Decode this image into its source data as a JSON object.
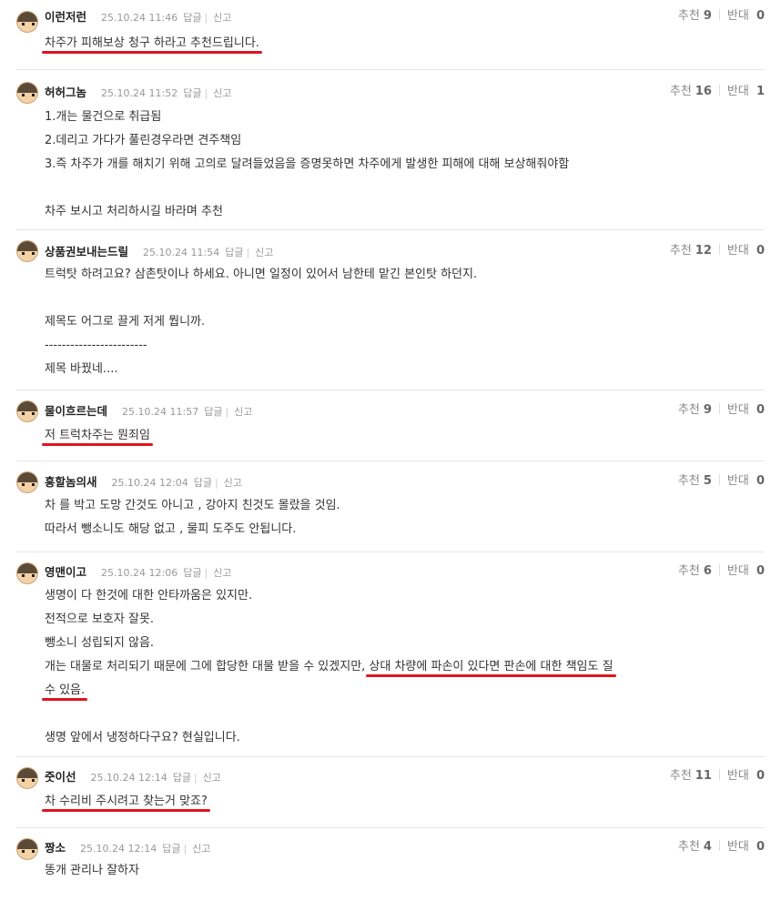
{
  "ui": {
    "reply_label": "답글",
    "report_label": "신고",
    "up_label": "추천",
    "down_label": "반대"
  },
  "comments": [
    {
      "nick": "이런저런",
      "date": "25.10.24 11:46",
      "up": "9",
      "down": "0",
      "lines": [
        "차주가 피해보상 청구 하라고 추천드립니다."
      ]
    },
    {
      "nick": "허허그놈",
      "date": "25.10.24 11:52",
      "up": "16",
      "down": "1",
      "lines": [
        "1.개는 물건으로 취급됨",
        "2.데리고 가다가 풀린경우라면 견주책임",
        "3.즉 차주가 개를 해치기 위해 고의로 달려들었음을 증명못하면 차주에게 발생한 피해에 대해 보상해줘야함",
        "",
        "차주 보시고 처리하시길 바라며 추천"
      ]
    },
    {
      "nick": "상품권보내는드릴",
      "date": "25.10.24 11:54",
      "up": "12",
      "down": "0",
      "lines": [
        "트럭탓 하려고요? 삼촌탓이나 하세요. 아니면 일정이 있어서 남한테 맡긴 본인탓 하던지.",
        "",
        "제목도 어그로 끌게 저게 뭡니까.",
        "------------------------",
        "제목 바꿨네...."
      ]
    },
    {
      "nick": "물이흐르는데",
      "date": "25.10.24 11:57",
      "up": "9",
      "down": "0",
      "lines": [
        "저 트럭차주는 뭔죄임"
      ]
    },
    {
      "nick": "흥할놈의새",
      "date": "25.10.24 12:04",
      "up": "5",
      "down": "0",
      "lines": [
        "차 를 박고 도망 간것도 아니고 , 강아지 친것도 몰랐을 것임.",
        "따라서 뺑소니도 해당 없고 , 물피 도주도 안됩니다."
      ]
    },
    {
      "nick": "영맨이고",
      "date": "25.10.24 12:06",
      "up": "6",
      "down": "0",
      "lines": [
        "생명이 다 한것에 대한 안타까움은 있지만.",
        "전적으로 보호자 잘못.",
        "뺑소니 성립되지 않음.",
        "개는 대물로 처리되기 때문에 그에 합당한 대물 받을 수 있겠지만, ",
        "상대 차량에 파손이 있다면 판손에 대한 책임도 질",
        "수 있음.",
        "",
        "생명 앞에서 냉정하다구요? 현실입니다."
      ]
    },
    {
      "nick": "줏이선",
      "date": "25.10.24 12:14",
      "up": "11",
      "down": "0",
      "lines": [
        "차 수리비 주시려고 찾는거 맞죠?"
      ]
    },
    {
      "nick": "짱소",
      "date": "25.10.24 12:14",
      "up": "4",
      "down": "0",
      "lines": [
        "똥개 관리나 잘하자"
      ]
    }
  ]
}
